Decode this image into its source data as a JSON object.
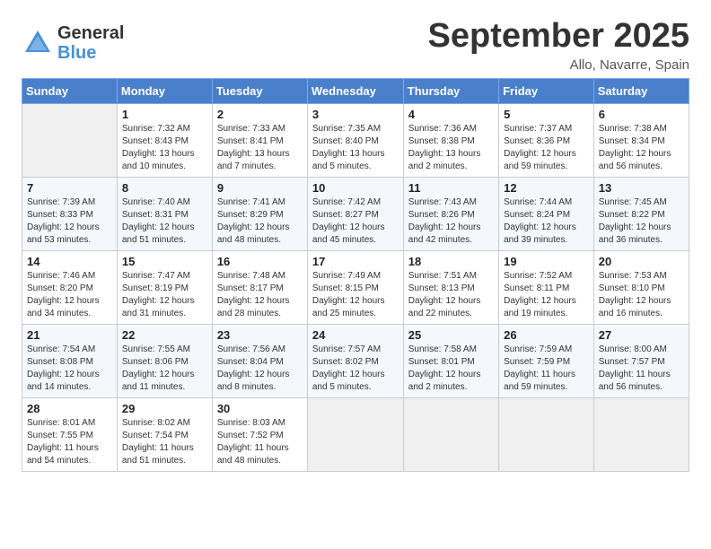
{
  "header": {
    "logo_general": "General",
    "logo_blue": "Blue",
    "month_title": "September 2025",
    "location": "Allo, Navarre, Spain"
  },
  "days_of_week": [
    "Sunday",
    "Monday",
    "Tuesday",
    "Wednesday",
    "Thursday",
    "Friday",
    "Saturday"
  ],
  "weeks": [
    [
      {
        "day": "",
        "info": ""
      },
      {
        "day": "1",
        "info": "Sunrise: 7:32 AM\nSunset: 8:43 PM\nDaylight: 13 hours\nand 10 minutes."
      },
      {
        "day": "2",
        "info": "Sunrise: 7:33 AM\nSunset: 8:41 PM\nDaylight: 13 hours\nand 7 minutes."
      },
      {
        "day": "3",
        "info": "Sunrise: 7:35 AM\nSunset: 8:40 PM\nDaylight: 13 hours\nand 5 minutes."
      },
      {
        "day": "4",
        "info": "Sunrise: 7:36 AM\nSunset: 8:38 PM\nDaylight: 13 hours\nand 2 minutes."
      },
      {
        "day": "5",
        "info": "Sunrise: 7:37 AM\nSunset: 8:36 PM\nDaylight: 12 hours\nand 59 minutes."
      },
      {
        "day": "6",
        "info": "Sunrise: 7:38 AM\nSunset: 8:34 PM\nDaylight: 12 hours\nand 56 minutes."
      }
    ],
    [
      {
        "day": "7",
        "info": "Sunrise: 7:39 AM\nSunset: 8:33 PM\nDaylight: 12 hours\nand 53 minutes."
      },
      {
        "day": "8",
        "info": "Sunrise: 7:40 AM\nSunset: 8:31 PM\nDaylight: 12 hours\nand 51 minutes."
      },
      {
        "day": "9",
        "info": "Sunrise: 7:41 AM\nSunset: 8:29 PM\nDaylight: 12 hours\nand 48 minutes."
      },
      {
        "day": "10",
        "info": "Sunrise: 7:42 AM\nSunset: 8:27 PM\nDaylight: 12 hours\nand 45 minutes."
      },
      {
        "day": "11",
        "info": "Sunrise: 7:43 AM\nSunset: 8:26 PM\nDaylight: 12 hours\nand 42 minutes."
      },
      {
        "day": "12",
        "info": "Sunrise: 7:44 AM\nSunset: 8:24 PM\nDaylight: 12 hours\nand 39 minutes."
      },
      {
        "day": "13",
        "info": "Sunrise: 7:45 AM\nSunset: 8:22 PM\nDaylight: 12 hours\nand 36 minutes."
      }
    ],
    [
      {
        "day": "14",
        "info": "Sunrise: 7:46 AM\nSunset: 8:20 PM\nDaylight: 12 hours\nand 34 minutes."
      },
      {
        "day": "15",
        "info": "Sunrise: 7:47 AM\nSunset: 8:19 PM\nDaylight: 12 hours\nand 31 minutes."
      },
      {
        "day": "16",
        "info": "Sunrise: 7:48 AM\nSunset: 8:17 PM\nDaylight: 12 hours\nand 28 minutes."
      },
      {
        "day": "17",
        "info": "Sunrise: 7:49 AM\nSunset: 8:15 PM\nDaylight: 12 hours\nand 25 minutes."
      },
      {
        "day": "18",
        "info": "Sunrise: 7:51 AM\nSunset: 8:13 PM\nDaylight: 12 hours\nand 22 minutes."
      },
      {
        "day": "19",
        "info": "Sunrise: 7:52 AM\nSunset: 8:11 PM\nDaylight: 12 hours\nand 19 minutes."
      },
      {
        "day": "20",
        "info": "Sunrise: 7:53 AM\nSunset: 8:10 PM\nDaylight: 12 hours\nand 16 minutes."
      }
    ],
    [
      {
        "day": "21",
        "info": "Sunrise: 7:54 AM\nSunset: 8:08 PM\nDaylight: 12 hours\nand 14 minutes."
      },
      {
        "day": "22",
        "info": "Sunrise: 7:55 AM\nSunset: 8:06 PM\nDaylight: 12 hours\nand 11 minutes."
      },
      {
        "day": "23",
        "info": "Sunrise: 7:56 AM\nSunset: 8:04 PM\nDaylight: 12 hours\nand 8 minutes."
      },
      {
        "day": "24",
        "info": "Sunrise: 7:57 AM\nSunset: 8:02 PM\nDaylight: 12 hours\nand 5 minutes."
      },
      {
        "day": "25",
        "info": "Sunrise: 7:58 AM\nSunset: 8:01 PM\nDaylight: 12 hours\nand 2 minutes."
      },
      {
        "day": "26",
        "info": "Sunrise: 7:59 AM\nSunset: 7:59 PM\nDaylight: 11 hours\nand 59 minutes."
      },
      {
        "day": "27",
        "info": "Sunrise: 8:00 AM\nSunset: 7:57 PM\nDaylight: 11 hours\nand 56 minutes."
      }
    ],
    [
      {
        "day": "28",
        "info": "Sunrise: 8:01 AM\nSunset: 7:55 PM\nDaylight: 11 hours\nand 54 minutes."
      },
      {
        "day": "29",
        "info": "Sunrise: 8:02 AM\nSunset: 7:54 PM\nDaylight: 11 hours\nand 51 minutes."
      },
      {
        "day": "30",
        "info": "Sunrise: 8:03 AM\nSunset: 7:52 PM\nDaylight: 11 hours\nand 48 minutes."
      },
      {
        "day": "",
        "info": ""
      },
      {
        "day": "",
        "info": ""
      },
      {
        "day": "",
        "info": ""
      },
      {
        "day": "",
        "info": ""
      }
    ]
  ]
}
